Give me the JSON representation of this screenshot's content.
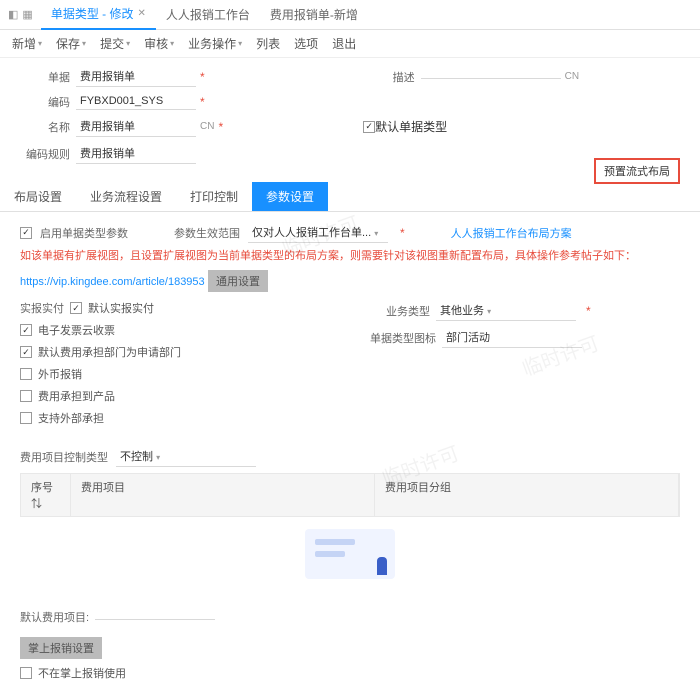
{
  "tabs": {
    "icons": [
      "◧",
      "▦"
    ],
    "items": [
      {
        "label": "单据类型 - 修改",
        "active": true
      },
      {
        "label": "人人报销工作台",
        "active": false
      },
      {
        "label": "费用报销单-新增",
        "active": false
      }
    ]
  },
  "toolbar": [
    "新增",
    "保存",
    "提交",
    "审核",
    "业务操作",
    "列表",
    "选项",
    "退出"
  ],
  "form": {
    "billLabel": "单据",
    "billValue": "费用报销单",
    "codeLabel": "编码",
    "codeValue": "FYBXD001_SYS",
    "nameLabel": "名称",
    "nameValue": "费用报销单",
    "ruleLabel": "编码规则",
    "ruleValue": "费用报销单",
    "descLabel": "描述",
    "descValue": "",
    "langTag": "CN",
    "defaultCheck": "默认单据类型"
  },
  "subtabs": [
    "布局设置",
    "业务流程设置",
    "打印控制",
    "参数设置"
  ],
  "params": {
    "enableLabel": "启用单据类型参数",
    "scopeLabel": "参数生效范围",
    "scopeValue": "仅对人人报销工作台单...",
    "layoutLink": "人人报销工作台布局方案",
    "presetBtn": "预置流式布局",
    "warnText": "如该单据有扩展视图，且设置扩展视图为当前单据类型的布局方案，则需要针对该视图重新配置布局，具体操作参考帖子如下：",
    "helpUrl": "https://vip.kingdee.com/article/183953"
  },
  "commonSection": {
    "title": "通用设置",
    "left": [
      {
        "k": "realPay",
        "label": "实报实付",
        "sub": "默认实报实付",
        "checked": true
      },
      {
        "k": "ecloud",
        "label": "电子发票云收票",
        "checked": true
      },
      {
        "k": "defaultDept",
        "label": "默认费用承担部门为申请部门",
        "checked": true
      },
      {
        "k": "external",
        "label": "外币报销",
        "checked": false
      },
      {
        "k": "toProduct",
        "label": "费用承担到产品",
        "checked": false
      },
      {
        "k": "supportExt",
        "label": "支持外部承担",
        "checked": false
      }
    ],
    "right": {
      "bizTypeLabel": "业务类型",
      "bizTypeValue": "其他业务",
      "iconLabel": "单据类型图标",
      "iconValue": "部门活动"
    }
  },
  "control": {
    "label": "费用项目控制类型",
    "value": "不控制",
    "columns": [
      "序号",
      "费用项目",
      "费用项目分组"
    ]
  },
  "defaults": {
    "label": "默认费用项目:",
    "section": "掌上报销设置",
    "noMobile": "不在掌上报销使用"
  },
  "watermark": "临时许可"
}
